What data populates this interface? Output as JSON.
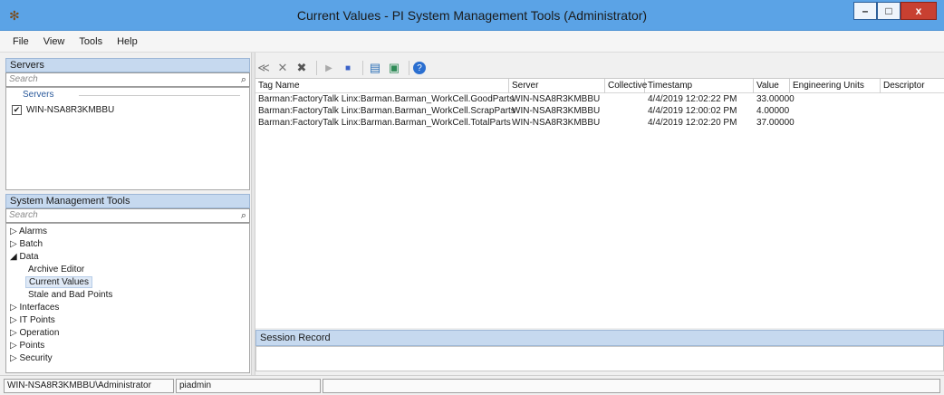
{
  "window": {
    "title": "Current Values - PI System Management Tools (Administrator)",
    "minimize": "–",
    "maximize": "□",
    "close": "x",
    "app_icon": "✻"
  },
  "menu": [
    "File",
    "View",
    "Tools",
    "Help"
  ],
  "servers_panel": {
    "header": "Servers",
    "search_placeholder": "Search",
    "group_label": "Servers",
    "items": [
      {
        "label": "WIN-NSA8R3KMBBU",
        "checked": true
      }
    ]
  },
  "smt_panel": {
    "header": "System Management Tools",
    "search_placeholder": "Search",
    "tree": [
      {
        "label": "Alarms",
        "expander": "▷",
        "level": 0
      },
      {
        "label": "Batch",
        "expander": "▷",
        "level": 0
      },
      {
        "label": "Data",
        "expander": "◢",
        "level": 0
      },
      {
        "label": "Archive Editor",
        "expander": "",
        "level": 1
      },
      {
        "label": "Current Values",
        "expander": "",
        "level": 1,
        "selected": true
      },
      {
        "label": "Stale and Bad Points",
        "expander": "",
        "level": 1
      },
      {
        "label": "Interfaces",
        "expander": "▷",
        "level": 0
      },
      {
        "label": "IT Points",
        "expander": "▷",
        "level": 0
      },
      {
        "label": "Operation",
        "expander": "▷",
        "level": 0
      },
      {
        "label": "Points",
        "expander": "▷",
        "level": 0
      },
      {
        "label": "Security",
        "expander": "▷",
        "level": 0
      }
    ]
  },
  "toolbar_icons": [
    "tag-search-icon",
    "remove-icon",
    "remove-all-icon",
    "play-icon",
    "stop-icon",
    "export-icon",
    "refresh-icon",
    "help-icon"
  ],
  "table": {
    "columns": [
      "Tag Name",
      "Server",
      "Collective",
      "Timestamp",
      "Value",
      "Engineering Units",
      "Descriptor"
    ],
    "rows": [
      [
        "Barman:FactoryTalk Linx:Barman.Barman_WorkCell.GoodParts",
        "WIN-NSA8R3KMBBU",
        "",
        "4/4/2019 12:02:22 PM",
        "33.00000",
        "",
        ""
      ],
      [
        "Barman:FactoryTalk Linx:Barman.Barman_WorkCell.ScrapParts",
        "WIN-NSA8R3KMBBU",
        "",
        "4/4/2019 12:00:02 PM",
        "4.00000",
        "",
        ""
      ],
      [
        "Barman:FactoryTalk Linx:Barman.Barman_WorkCell.TotalParts",
        "WIN-NSA8R3KMBBU",
        "",
        "4/4/2019 12:02:20 PM",
        "37.00000",
        "",
        ""
      ]
    ]
  },
  "session_record": {
    "header": "Session Record"
  },
  "status_bar": {
    "user": "WIN-NSA8R3KMBBU\\Administrator",
    "identity": "piadmin",
    "message": ""
  }
}
